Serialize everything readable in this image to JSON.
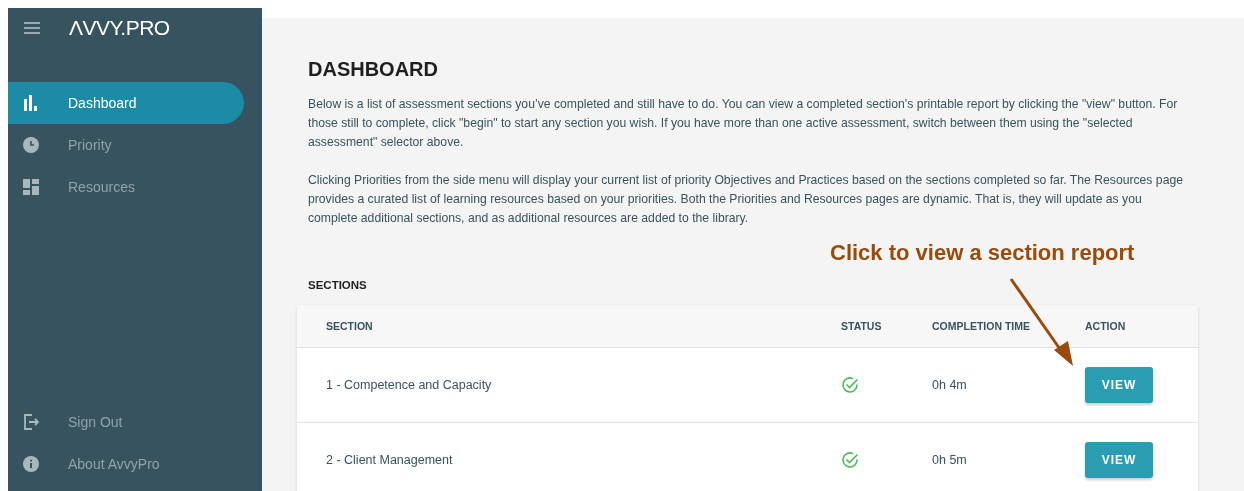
{
  "sidebar": {
    "logo": "ΛVVY.PRO",
    "items": [
      {
        "label": "Dashboard",
        "kind": "bars",
        "selected": true
      },
      {
        "label": "Priority",
        "kind": "clock",
        "selected": false
      },
      {
        "label": "Resources",
        "kind": "grid",
        "selected": false
      }
    ],
    "footer_items": [
      {
        "label": "Sign Out",
        "kind": "exit"
      },
      {
        "label": "About AvvyPro",
        "kind": "info"
      }
    ]
  },
  "page": {
    "title": "DASHBOARD",
    "paragraphs": [
      "Below is a list of assessment sections you’ve completed and still have to do. You can view a completed section's printable report by clicking the \"view\" button. For those still to complete, click \"begin\" to start any section you wish. If you have more than one active assessment, switch between them using the \"selected assessment\" selector above.",
      "Clicking Priorities from the side menu will display your current list of priority Objectives and Practices based on the sections completed so far. The Resources page provides a curated list of learning resources based on your priorities. Both the Priorities and Resources pages are dynamic. That is, they will update as you complete additional sections, and as additional resources are added to the library."
    ],
    "sections_heading": "SECTIONS",
    "annotation": "Click to view a section report"
  },
  "table": {
    "columns": [
      "SECTION",
      "STATUS",
      "COMPLETION TIME",
      "ACTION"
    ],
    "rows": [
      {
        "section": "1 - Competence and Capacity",
        "completed": true,
        "time": "0h 4m",
        "action": "VIEW"
      },
      {
        "section": "2 - Client Management",
        "completed": true,
        "time": "0h 5m",
        "action": "VIEW"
      }
    ]
  }
}
